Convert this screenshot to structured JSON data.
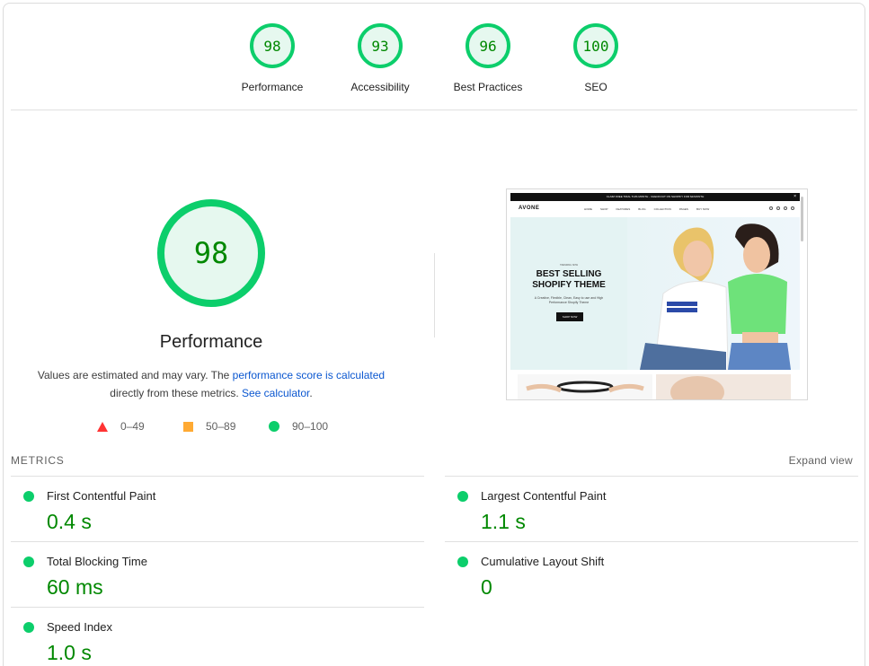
{
  "categories": [
    {
      "score": "98",
      "label": "Performance"
    },
    {
      "score": "93",
      "label": "Accessibility"
    },
    {
      "score": "96",
      "label": "Best Practices"
    },
    {
      "score": "100",
      "label": "SEO"
    }
  ],
  "main": {
    "score": "98",
    "title": "Performance",
    "desc_prefix": "Values are estimated and may vary. The ",
    "desc_link1": "performance score is calculated",
    "desc_middle": "directly from these metrics. ",
    "desc_link2": "See calculator",
    "desc_suffix": "."
  },
  "legend": {
    "fail": "0–49",
    "average": "50–89",
    "pass": "90–100"
  },
  "screenshot": {
    "announce": "CLAIM FREE TRIAL THIS MONTH - CHECKOUT ON SHOPIFY FOR $1/MONTH",
    "close": "×",
    "logo": "AVONE",
    "menu": [
      "HOME",
      "SHOP",
      "FEATURES",
      "BLOG",
      "COLLECTION",
      "PAGES",
      "BUY NOW"
    ],
    "eyebrow": "TRENDING NOW",
    "headline_1": "BEST SELLING",
    "headline_2": "SHOPIFY THEME",
    "body": "A Creative, Flexible, Clean, Easy to use and High Performance Shopify Theme",
    "button": "SHOP NOW"
  },
  "metrics": {
    "title": "METRICS",
    "expand": "Expand view",
    "left": [
      {
        "label": "First Contentful Paint",
        "value": "0.4 s"
      },
      {
        "label": "Total Blocking Time",
        "value": "60 ms"
      },
      {
        "label": "Speed Index",
        "value": "1.0 s"
      }
    ],
    "right": [
      {
        "label": "Largest Contentful Paint",
        "value": "1.1 s"
      },
      {
        "label": "Cumulative Layout Shift",
        "value": "0"
      }
    ]
  },
  "colors": {
    "pass": "#0cce6b",
    "pass_text": "#008800",
    "average": "#ffaa33",
    "fail": "#ff3333",
    "link": "#0b57d0"
  }
}
